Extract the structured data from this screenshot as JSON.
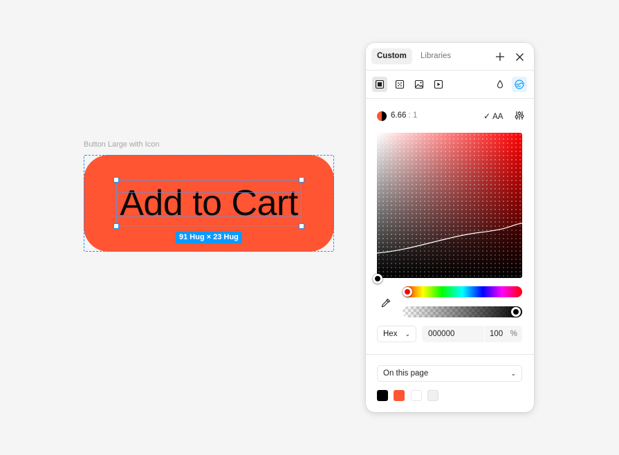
{
  "canvas": {
    "frame_label": "Button Large with Icon",
    "button_text": "Add to Cart",
    "size_badge": "91 Hug × 23 Hug",
    "button_color": "#ff5533"
  },
  "panel": {
    "tabs": [
      "Custom",
      "Libraries"
    ],
    "active_tab": "Custom",
    "top_icons": [
      "plus-icon",
      "close-icon"
    ],
    "paint_types": [
      "solid-fill-icon",
      "gradient-fill-icon",
      "image-fill-icon",
      "video-fill-icon"
    ],
    "mode_icons": [
      "opacity-drop-icon",
      "contrast-mode-icon"
    ],
    "contrast": {
      "ratio": "6.66",
      "unit": ": 1",
      "rating": "AA",
      "check": "✓"
    },
    "hue_color": "#ff0000",
    "format": {
      "label": "Hex",
      "value": "000000",
      "alpha": "100",
      "alpha_unit": "%"
    },
    "library": {
      "label": "On this page"
    },
    "swatches": [
      "#000000",
      "#ff5533",
      "#ffffff",
      "#f0f0f0"
    ]
  }
}
